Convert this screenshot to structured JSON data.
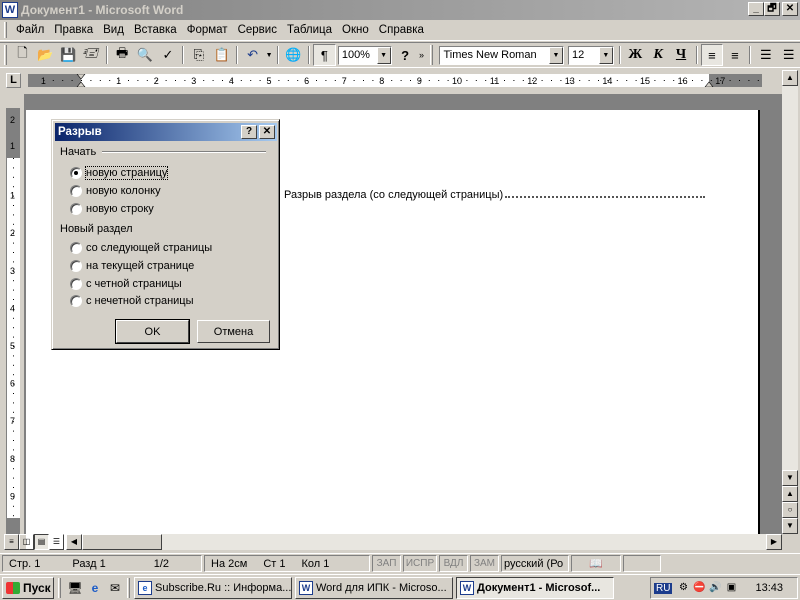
{
  "window": {
    "title": "Документ1 - Microsoft Word",
    "app_icon": "W",
    "controls": [
      "_",
      "🗗",
      "✕"
    ]
  },
  "menu": {
    "items": [
      "Файл",
      "Правка",
      "Вид",
      "Вставка",
      "Формат",
      "Сервис",
      "Таблица",
      "Окно",
      "Справка"
    ]
  },
  "toolbar": {
    "zoom": "100%",
    "font": "Times New Roman",
    "size": "12",
    "bold": "Ж",
    "italic": "К",
    "underline": "Ч"
  },
  "ruler": {
    "corner": "L",
    "h_labels": [
      "1",
      "1",
      "2",
      "3",
      "4",
      "5",
      "6",
      "7",
      "8",
      "9",
      "10",
      "11",
      "12",
      "13",
      "14",
      "15",
      "16",
      "17"
    ],
    "v_labels": [
      "2",
      "1",
      "1",
      "2",
      "3",
      "4",
      "5",
      "6",
      "7",
      "8",
      "9"
    ]
  },
  "document": {
    "section_break_text": "Разрыв раздела (со следующей страницы)"
  },
  "dialog": {
    "title": "Разрыв",
    "help": "?",
    "close": "✕",
    "start_group": "Начать",
    "start_options": [
      "новую страницу",
      "новую колонку",
      "новую строку"
    ],
    "start_selected": 0,
    "section_group": "Новый раздел",
    "section_options": [
      "со следующей страницы",
      "на текущей странице",
      "с четной страницы",
      "с нечетной страницы"
    ],
    "ok": "OK",
    "cancel": "Отмена"
  },
  "status": {
    "page": "Стр. 1",
    "section": "Разд 1",
    "pages": "1/2",
    "at": "На 2см",
    "line": "Ст 1",
    "col": "Кол 1",
    "rec": "ЗАП",
    "trk": "ИСПР",
    "ext": "ВДЛ",
    "ovr": "ЗАМ",
    "lang": "русский (Ро"
  },
  "taskbar": {
    "start": "Пуск",
    "tasks": [
      {
        "label": "Subscribe.Ru :: Информа...",
        "icon": "e",
        "active": false
      },
      {
        "label": "Word для ИПК - Microso...",
        "icon": "W",
        "active": false
      },
      {
        "label": "Документ1 - Microsof...",
        "icon": "W",
        "active": true
      }
    ],
    "lang": "RU",
    "clock": "13:43"
  }
}
